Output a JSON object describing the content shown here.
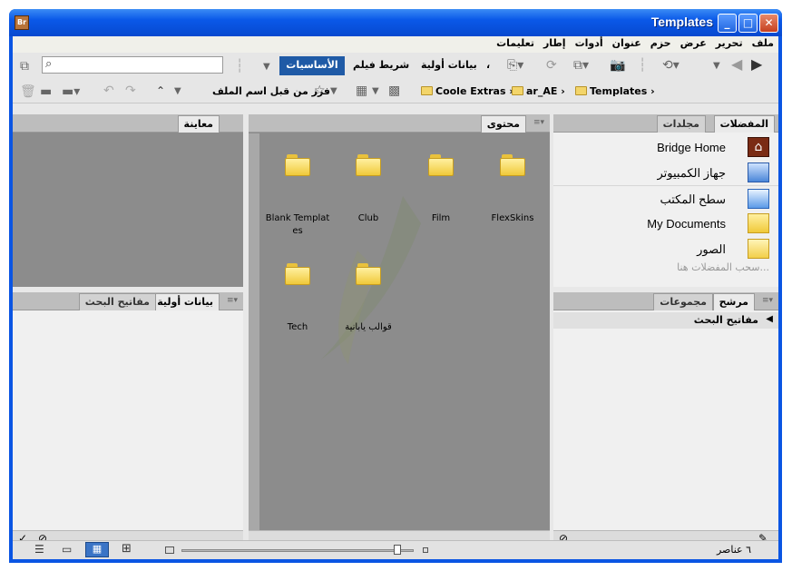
{
  "window": {
    "title": "Templates",
    "app_badge": "Br",
    "minimize": "_",
    "maximize": "□",
    "close": "✕"
  },
  "menu": [
    "ملف",
    "تحرير",
    "عرض",
    "حزم",
    "عنوان",
    "أدوات",
    "إطار",
    "تعليمات"
  ],
  "toolbar": {
    "search_placeholder": "",
    "workspace_active": "الأساسيات",
    "workspace_filmstrip": "شريط فيلم",
    "workspace_metadata": "بيانات أولية",
    "workspace_more": "،"
  },
  "toolbar2": {
    "sort_label": "فرز من قبل اسم الملف",
    "breadcrumb": [
      "Coole Extras",
      "ar_AE",
      "Templates"
    ]
  },
  "panels": {
    "favorites_tab": "المفضلات",
    "folders_tab": "مجلدات",
    "content_tab": "محتوى",
    "preview_tab": "معاينة",
    "metadata_tab": "بيانات أولية",
    "keywords_tab": "مفاتيح البحث",
    "filter_tab": "مرشح",
    "collections_tab": "مجموعات",
    "keywords_header": "مفاتيح البحث"
  },
  "favorites": [
    {
      "label": "Bridge Home",
      "icon": "bridge-home-icon"
    },
    {
      "label": "جهاز الكمبيوتر",
      "icon": "computer-icon"
    },
    {
      "label": "سطح المكتب",
      "icon": "desktop-icon"
    },
    {
      "label": "My Documents",
      "icon": "folder-icon"
    },
    {
      "label": "الصور",
      "icon": "pictures-folder-icon"
    }
  ],
  "favorites_hint": "سحب المفضلات هنا...",
  "content_items": [
    {
      "label": "Blank Templat\nes"
    },
    {
      "label": "Club"
    },
    {
      "label": "Film"
    },
    {
      "label": "FlexSkins"
    },
    {
      "label": "Tech"
    },
    {
      "label": "قوالب يابانية"
    }
  ],
  "status": {
    "item_count": "٦ عناصر"
  },
  "colors": {
    "titlebar": "#0a55e3",
    "workspace_active": "#1f5aa6",
    "content_bg": "#8c8c8c"
  }
}
